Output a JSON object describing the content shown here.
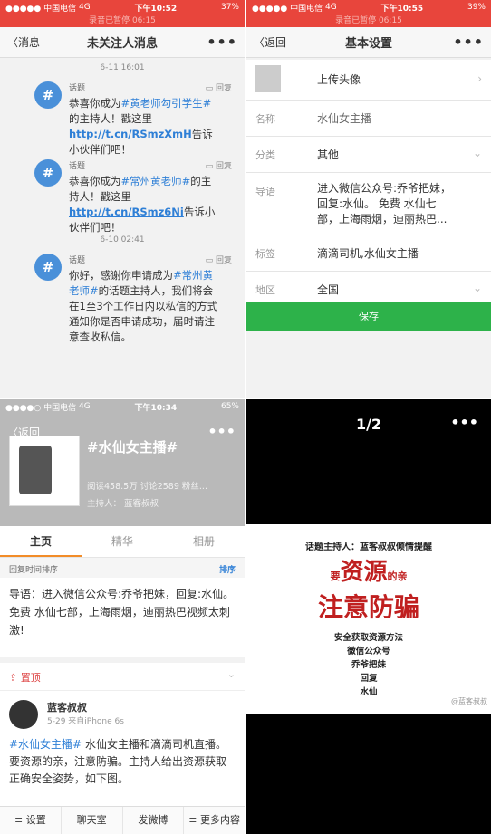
{
  "p1": {
    "status": {
      "carrier": "●●●●● 中国电信",
      "network": "4G",
      "time": "下午10:52",
      "battery": "37%",
      "sub": "录音已暂停 06:15"
    },
    "nav": {
      "back": "消息",
      "title": "未关注人消息",
      "more": "•••"
    },
    "dates": [
      "6-11 16:01",
      "6-10 02:41"
    ],
    "messages": [
      {
        "from": "话题",
        "reply": "回复",
        "pre": "恭喜你成为",
        "tag": "#黄老师勾引学生#",
        "mid": "的主持人！戳这里",
        "link": "http://t.cn/RSmzXmH",
        "post": "告诉小伙伴们吧！"
      },
      {
        "from": "话题",
        "reply": "回复",
        "pre": "恭喜你成为",
        "tag": "#常州黄老师#",
        "mid": "的主持人！戳这里",
        "link": "http://t.cn/RSmz6Ni",
        "post": "告诉小伙伴们吧！"
      },
      {
        "from": "话题",
        "reply": "回复",
        "pre": "你好，感谢你申请成为",
        "tag": "#常州黄老师#",
        "post": "的话题主持人，我们将会在1至3个工作日内以私信的方式通知你是否申请成功，届时请注意查收私信。"
      }
    ]
  },
  "p2": {
    "status": {
      "carrier": "●●●●● 中国电信",
      "network": "4G",
      "time": "下午10:55",
      "battery": "39%",
      "sub": "录音已暂停 06:15"
    },
    "nav": {
      "back": "返回",
      "title": "基本设置",
      "more": "•••"
    },
    "avatar_row": "上传头像",
    "rows": [
      {
        "label": "名称",
        "value": "水仙女主播"
      },
      {
        "label": "分类",
        "value": "其他"
      },
      {
        "label": "导语",
        "value": "进入微信公众号:乔爷把妹，回复:水仙。 免费 水仙七部，上海雨烟，迪丽热巴..."
      },
      {
        "label": "标签",
        "value": "滴滴司机,水仙女主播"
      },
      {
        "label": "地区",
        "value": "全国"
      }
    ],
    "save": "保存"
  },
  "p3": {
    "status": {
      "carrier": "●●●●○ 中国电信",
      "network": "4G",
      "time": "下午10:34",
      "battery": "65%"
    },
    "back": "返回",
    "more": "•••",
    "topic": "#水仙女主播#",
    "stats": "阅读458.5万   讨论2589   粉丝...",
    "host": "主持人： 蓝客叔叔",
    "tabs": [
      "主页",
      "精华",
      "相册"
    ],
    "sort": {
      "left": "回复时间排序",
      "right": "排序"
    },
    "intro": "导语：进入微信公众号:乔爷把妹，回复:水仙。 免费 水仙七部，上海雨烟，迪丽热巴视频太刺激!",
    "pin": "置顶",
    "post": {
      "user": "蓝客叔叔",
      "time": "5-29  来自iPhone 6s",
      "tag": "#水仙女主播#",
      "text": " 水仙女主播和滴滴司机直播。要资源的亲，注意防骗。主持人给出资源获取正确安全姿势，如下图。"
    },
    "bottom": [
      "设置",
      "聊天室",
      "发微博",
      "更多内容"
    ]
  },
  "p4": {
    "page": "1/2",
    "more": "•••",
    "poster": {
      "line1": "话题主持人：蓝客叔叔倾情提醒",
      "small1": "要",
      "big1": "资源",
      "small2": "的亲",
      "big2": "注意防骗",
      "instructions": [
        "安全获取资源方法",
        "微信公众号",
        "乔爷把妹",
        "回复",
        "水仙"
      ],
      "watermark": "@蓝客叔叔"
    }
  }
}
